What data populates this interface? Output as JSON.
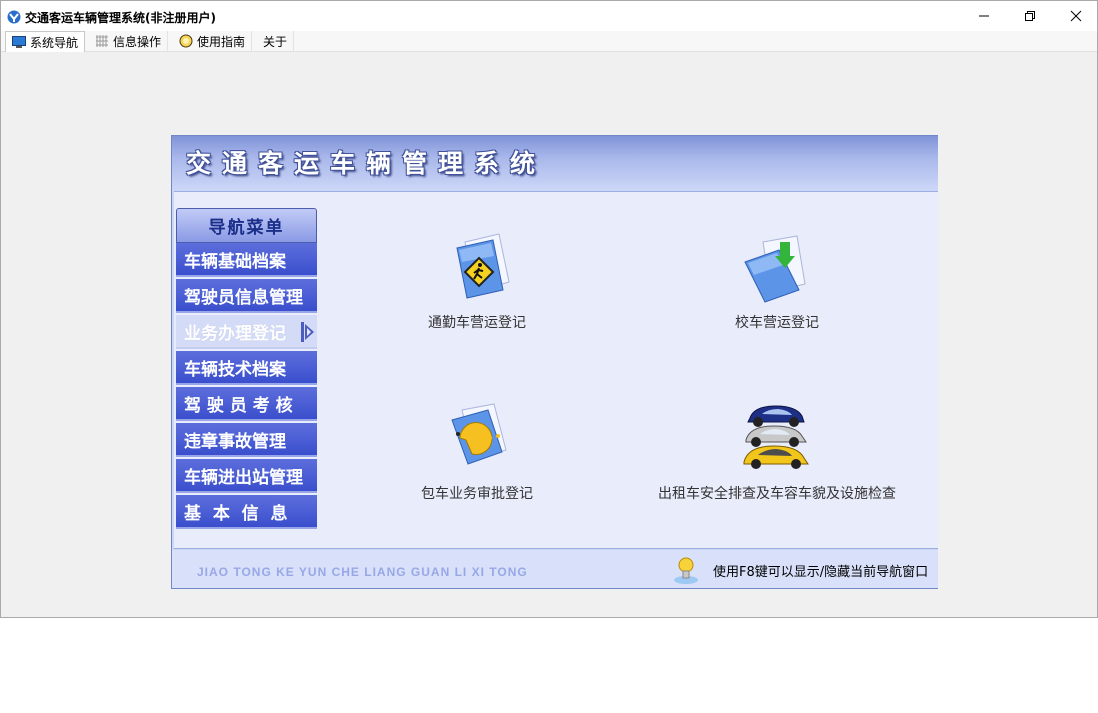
{
  "window": {
    "title": "交通客运车辆管理系统(非注册用户)",
    "controls": {
      "minimize": "minimize-icon",
      "restore": "restore-icon",
      "close": "close-icon"
    }
  },
  "menubar": {
    "items": [
      {
        "label": "系统导航",
        "icon": "monitor-icon"
      },
      {
        "label": "信息操作",
        "icon": "grid-icon"
      },
      {
        "label": "使用指南",
        "icon": "guide-icon"
      },
      {
        "label": "关于"
      }
    ]
  },
  "banner": {
    "title": "交通客运车辆管理系统"
  },
  "nav": {
    "header": "导航菜单",
    "items": [
      {
        "label": "车辆基础档案"
      },
      {
        "label": "驾驶员信息管理"
      },
      {
        "label": "业务办理登记"
      },
      {
        "label": "车辆技术档案"
      },
      {
        "label": "驾 驶 员 考 核"
      },
      {
        "label": "违章事故管理"
      },
      {
        "label": "车辆进出站管理"
      },
      {
        "label": "基  本  信  息"
      }
    ],
    "active_index": 2
  },
  "tiles": [
    {
      "label": "通勤车营运登记",
      "icon": "pedestrian-document-icon"
    },
    {
      "label": "校车营运登记",
      "icon": "download-document-icon"
    },
    {
      "label": "包车业务审批登记",
      "icon": "pacman-document-icon"
    },
    {
      "label": "出租车安全排查及车容车貌及设施检查",
      "icon": "cars-icon"
    }
  ],
  "footer": {
    "pinyin": "JIAO TONG KE YUN CHE LIANG GUAN LI XI TONG",
    "hint": "使用F8键可以显示/隐藏当前导航窗口"
  },
  "colors": {
    "nav_blue": "#3a4fcd",
    "banner_blue": "#7f93d8",
    "content_bg": "#e9ecfb"
  }
}
